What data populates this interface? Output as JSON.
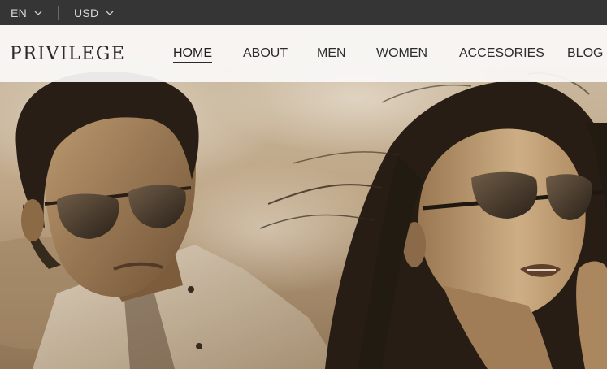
{
  "topbar": {
    "language": "EN",
    "currency": "USD"
  },
  "brand": {
    "logo_text": "PRIVILEGE"
  },
  "nav": {
    "items": [
      {
        "label": "HOME",
        "active": true
      },
      {
        "label": "ABOUT",
        "active": false
      },
      {
        "label": "MEN",
        "active": false
      },
      {
        "label": "WOMEN",
        "active": false
      },
      {
        "label": "ACCESORIES",
        "active": false
      },
      {
        "label": "BLOG",
        "active": false
      }
    ]
  },
  "hero": {
    "theme": "sepia",
    "colors": {
      "sky": "#c9b59a",
      "shadow": "#2b2118",
      "skin": "#b8956b"
    },
    "icons": [
      "chevron-down-icon"
    ]
  }
}
